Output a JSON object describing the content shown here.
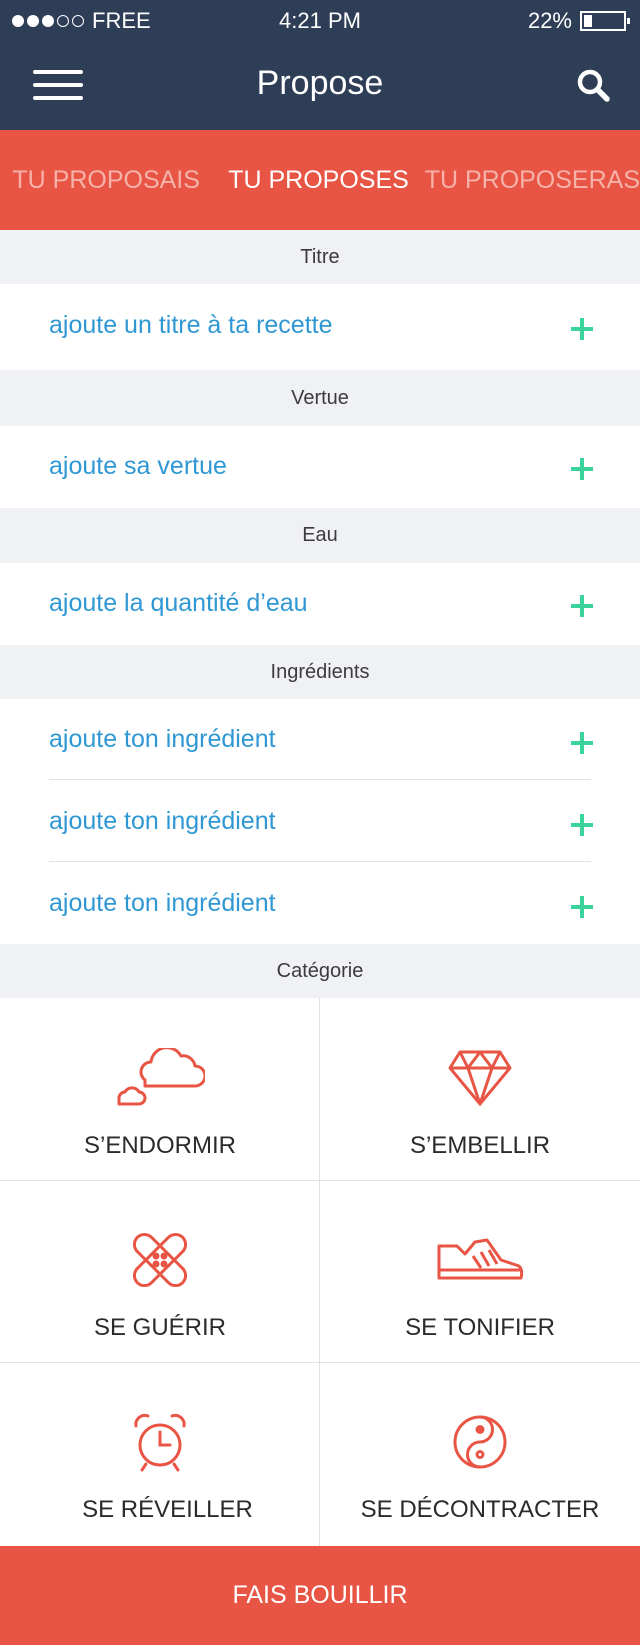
{
  "status_bar": {
    "carrier": "FREE",
    "time": "4:21  PM",
    "battery_percent": "22%",
    "battery_level": 0.22,
    "signal_bars_filled": 3,
    "signal_bars_total": 5
  },
  "nav": {
    "title": "Propose",
    "menu_icon": "hamburger-menu-icon",
    "search_icon": "search-icon"
  },
  "tabs": [
    {
      "label": "TU PROPOSAIS",
      "active": false
    },
    {
      "label": "TU PROPOSES",
      "active": true
    },
    {
      "label": "TU PROPOSERAS",
      "active": false
    }
  ],
  "sections": {
    "titre": {
      "header": "Titre",
      "placeholder": "ajoute un titre à ta recette"
    },
    "vertue": {
      "header": "Vertue",
      "placeholder": "ajoute sa vertue"
    },
    "eau": {
      "header": "Eau",
      "placeholder": "ajoute la quantité d’eau"
    },
    "ingredients": {
      "header": "Ingrédients",
      "items": [
        "ajoute ton ingrédient",
        "ajoute ton ingrédient",
        "ajoute ton ingrédient"
      ]
    },
    "categorie": {
      "header": "Catégorie",
      "items": [
        {
          "label": "S’ENDORMIR",
          "icon": "clouds-icon"
        },
        {
          "label": "S’EMBELLIR",
          "icon": "diamond-icon"
        },
        {
          "label": "SE GUÉRIR",
          "icon": "bandage-icon"
        },
        {
          "label": "SE TONIFIER",
          "icon": "sneaker-icon"
        },
        {
          "label": "SE RÉVEILLER",
          "icon": "alarm-clock-icon"
        },
        {
          "label": "SE DÉCONTRACTER",
          "icon": "yin-yang-icon"
        }
      ]
    }
  },
  "cta": {
    "label": "FAIS BOUILLIR"
  },
  "colors": {
    "nav_bg": "#2f3e57",
    "accent_red": "#e85545",
    "link_blue": "#2f97d3",
    "plus_green": "#3bd39c",
    "section_bg": "#f0f1f5"
  }
}
